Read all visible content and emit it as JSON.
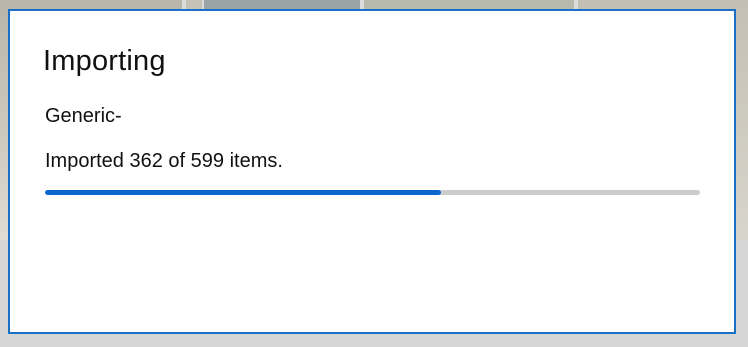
{
  "dialog": {
    "title": "Importing",
    "device_name": "Generic-",
    "status": "Imported 362 of 599 items.",
    "progress": {
      "imported": 362,
      "total": 599,
      "fraction": 0.604
    }
  },
  "colors": {
    "accent": "#0a66cf",
    "dialog_border": "#1a6fc7",
    "track": "#cccccc"
  }
}
